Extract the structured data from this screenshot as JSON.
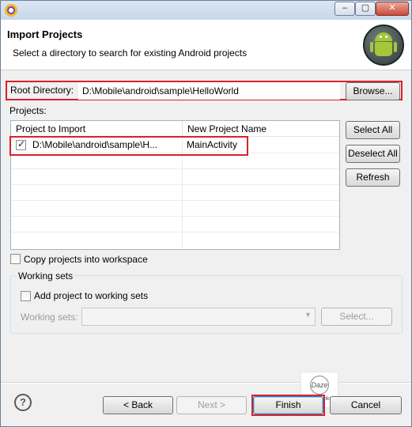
{
  "dialog": {
    "title": "Import Projects",
    "description": "Select a directory to search for existing Android projects"
  },
  "root_directory": {
    "label": "Root Directory:",
    "value": "D:\\Mobile\\android\\sample\\HelloWorld",
    "browse_label": "Browse..."
  },
  "projects": {
    "label": "Projects:",
    "columns": [
      "Project to Import",
      "New Project Name"
    ],
    "rows": [
      {
        "project": "D:\\Mobile\\android\\sample\\H...",
        "new_name": "MainActivity",
        "checked": true
      }
    ],
    "select_all_label": "Select All",
    "deselect_all_label": "Deselect All",
    "refresh_label": "Refresh"
  },
  "copy_projects": {
    "label": "Copy projects into workspace",
    "checked": false
  },
  "working_sets": {
    "group_label": "Working sets",
    "add_label": "Add project to working sets",
    "field_label": "Working sets:",
    "select_label": "Select..."
  },
  "footer": {
    "help_glyph": "?",
    "back_label": "< Back",
    "next_label": "Next >",
    "finish_label": "Finish",
    "cancel_label": "Cancel"
  },
  "window_controls": {
    "minimize": "–",
    "maximize": "▢",
    "close": "✕"
  },
  "icons": {
    "app": "eclipse-icon",
    "header": "android-icon",
    "help": "help-icon"
  },
  "colors": {
    "highlight": "#d9212e",
    "android_green": "#a4c639"
  }
}
